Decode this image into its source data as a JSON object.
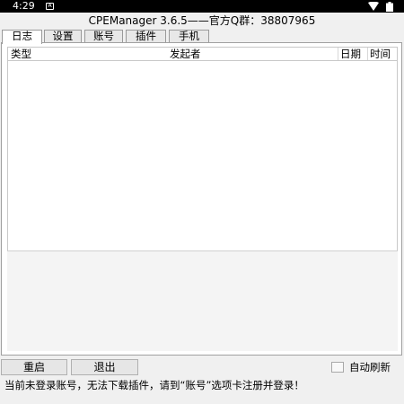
{
  "statusbar": {
    "time": "4:29",
    "notification_glyph": "A",
    "icons": [
      "notification-icon",
      "wifi-icon",
      "battery-icon"
    ]
  },
  "window": {
    "title": "CPEManager 3.6.5——官方Q群：38807965"
  },
  "tabs": [
    {
      "label": "日志",
      "active": true
    },
    {
      "label": "设置",
      "active": false
    },
    {
      "label": "账号",
      "active": false
    },
    {
      "label": "插件",
      "active": false
    },
    {
      "label": "手机",
      "active": false
    }
  ],
  "log_table": {
    "columns": [
      "类型",
      "发起者",
      "日期",
      "时间"
    ],
    "rows": []
  },
  "buttons": {
    "restart": "重启",
    "exit": "退出"
  },
  "auto_refresh": {
    "label": "自动刷新",
    "checked": false
  },
  "status_message": "当前未登录账号，无法下载插件，请到“账号”选项卡注册并登录！"
}
